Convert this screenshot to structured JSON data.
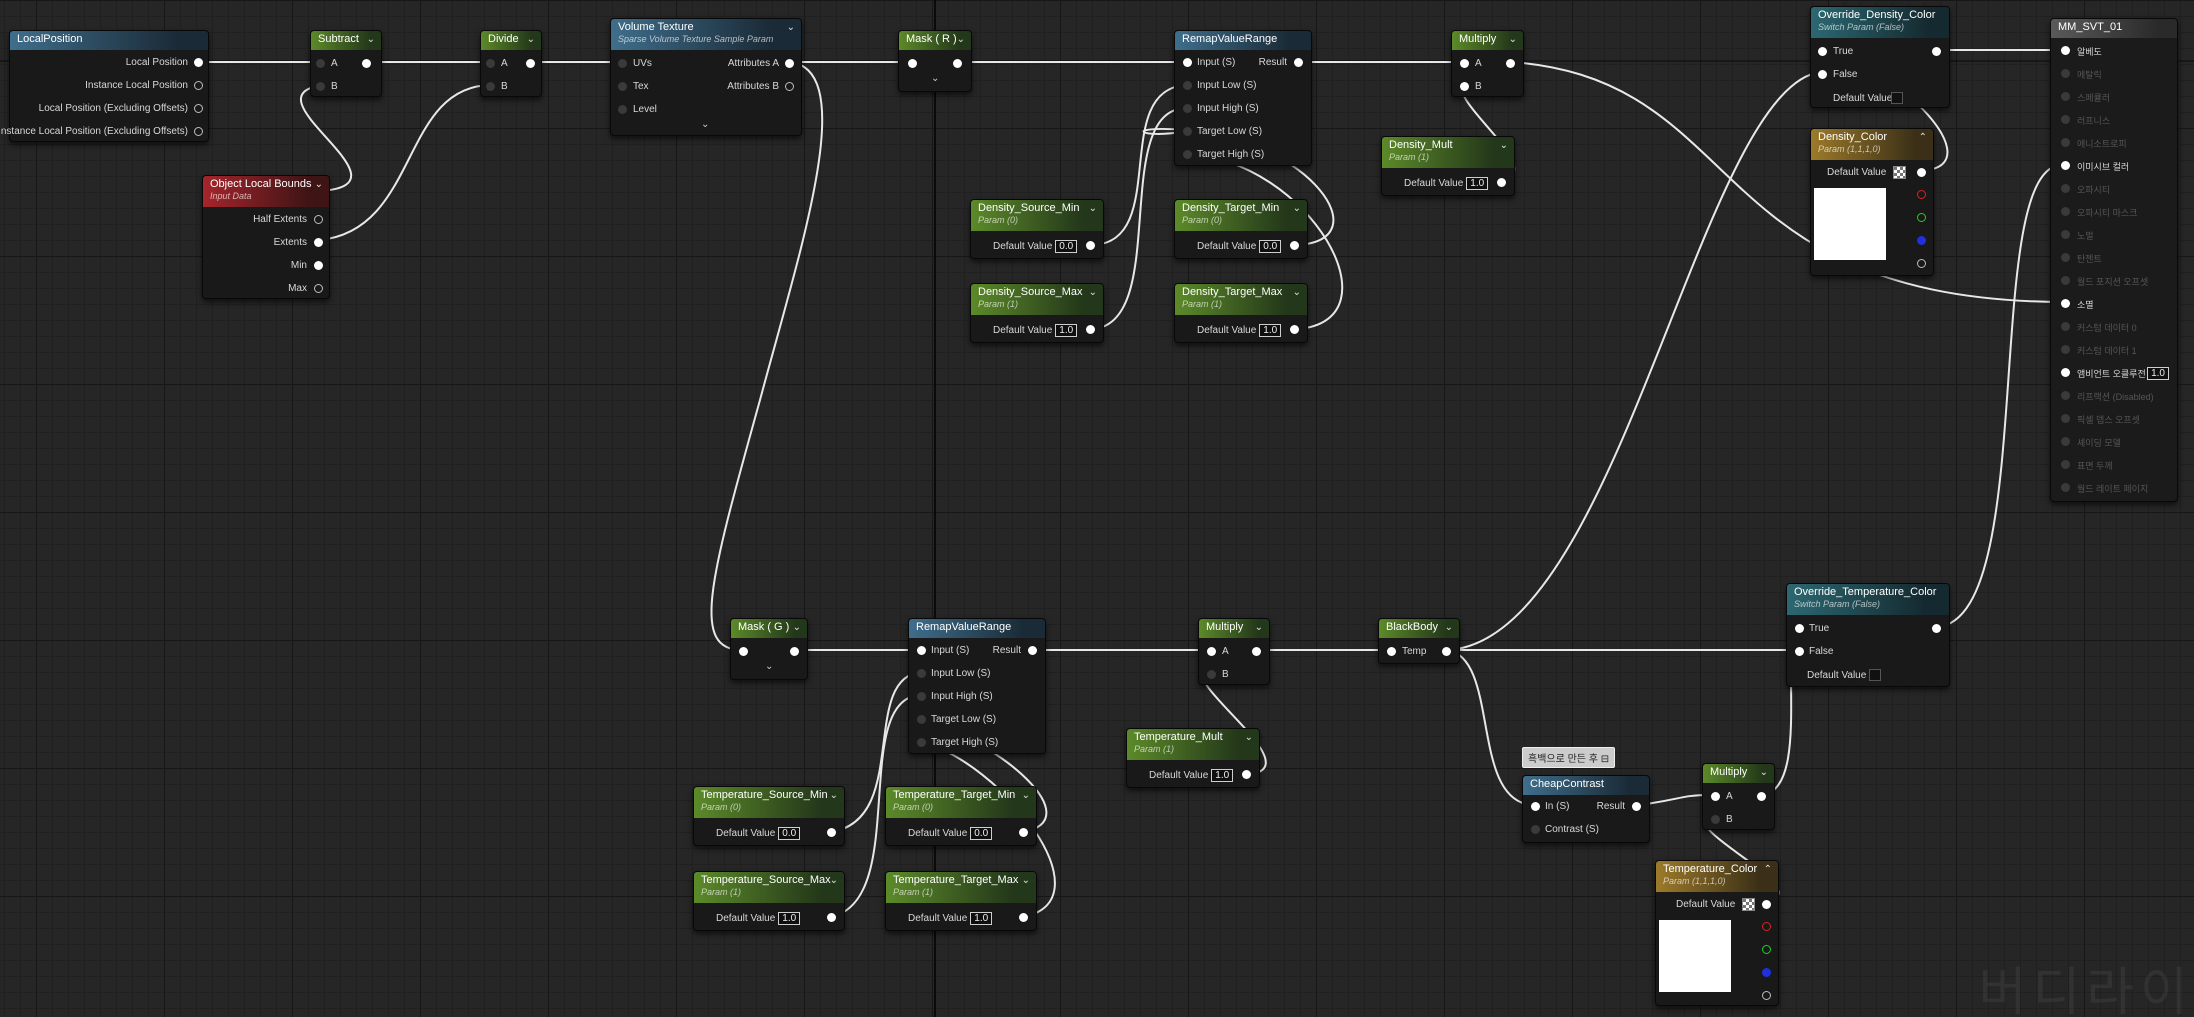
{
  "nodes": {
    "local_position": {
      "title": "LocalPosition",
      "outputs": [
        "Local Position",
        "Instance Local Position",
        "Local Position (Excluding Offsets)",
        "Instance Local Position (Excluding Offsets)"
      ]
    },
    "subtract": {
      "title": "Subtract",
      "a": "A",
      "b": "B"
    },
    "divide": {
      "title": "Divide",
      "a": "A",
      "b": "B"
    },
    "object_local_bounds": {
      "title": "Object Local Bounds",
      "subtitle": "Input Data",
      "outputs": [
        "Half Extents",
        "Extents",
        "Min",
        "Max"
      ]
    },
    "volume_texture": {
      "title": "Volume Texture",
      "subtitle": "Sparse Volume Texture Sample Param",
      "inputs": [
        "UVs",
        "Tex",
        "Level"
      ],
      "outputs": [
        "Attributes A",
        "Attributes B"
      ]
    },
    "mask_r": {
      "title": "Mask ( R )"
    },
    "mask_g": {
      "title": "Mask ( G )"
    },
    "remap_density": {
      "title": "RemapValueRange",
      "inputs": [
        "Input (S)",
        "Input Low (S)",
        "Input High (S)",
        "Target Low (S)",
        "Target High (S)"
      ],
      "output": "Result"
    },
    "remap_temperature": {
      "title": "RemapValueRange",
      "inputs": [
        "Input (S)",
        "Input Low (S)",
        "Input High (S)",
        "Target Low (S)",
        "Target High (S)"
      ],
      "output": "Result"
    },
    "density_source_min": {
      "title": "Density_Source_Min",
      "subtitle": "Param (0)",
      "label": "Default Value",
      "value": "0.0"
    },
    "density_source_max": {
      "title": "Density_Source_Max",
      "subtitle": "Param (1)",
      "label": "Default Value",
      "value": "1.0"
    },
    "density_target_min": {
      "title": "Density_Target_Min",
      "subtitle": "Param (0)",
      "label": "Default Value",
      "value": "0.0"
    },
    "density_target_max": {
      "title": "Density_Target_Max",
      "subtitle": "Param (1)",
      "label": "Default Value",
      "value": "1.0"
    },
    "multiply_density": {
      "title": "Multiply",
      "a": "A",
      "b": "B"
    },
    "density_mult": {
      "title": "Density_Mult",
      "subtitle": "Param (1)",
      "label": "Default Value",
      "value": "1.0"
    },
    "override_density_color": {
      "title": "Override_Density_Color",
      "subtitle": "Switch Param (False)",
      "true": "True",
      "false": "False",
      "default": "Default Value"
    },
    "density_color": {
      "title": "Density_Color",
      "subtitle": "Param (1,1,1,0)",
      "label": "Default Value"
    },
    "temperature_source_min": {
      "title": "Temperature_Source_Min",
      "subtitle": "Param (0)",
      "label": "Default Value",
      "value": "0.0"
    },
    "temperature_source_max": {
      "title": "Temperature_Source_Max",
      "subtitle": "Param (1)",
      "label": "Default Value",
      "value": "1.0"
    },
    "temperature_target_min": {
      "title": "Temperature_Target_Min",
      "subtitle": "Param (0)",
      "label": "Default Value",
      "value": "0.0"
    },
    "temperature_target_max": {
      "title": "Temperature_Target_Max",
      "subtitle": "Param (1)",
      "label": "Default Value",
      "value": "1.0"
    },
    "multiply_temp": {
      "title": "Multiply",
      "a": "A",
      "b": "B"
    },
    "temperature_mult": {
      "title": "Temperature_Mult",
      "subtitle": "Param (1)",
      "label": "Default Value",
      "value": "1.0"
    },
    "blackbody": {
      "title": "BlackBody",
      "input": "Temp"
    },
    "override_temperature_color": {
      "title": "Override_Temperature_Color",
      "subtitle": "Switch Param (False)",
      "true": "True",
      "false": "False",
      "default": "Default Value"
    },
    "comment": {
      "text": "흑백으로 만든 후"
    },
    "cheap_contrast": {
      "title": "CheapContrast",
      "inputs": [
        "In (S)",
        "Contrast (S)"
      ],
      "output": "Result"
    },
    "multiply_contrast": {
      "title": "Multiply",
      "a": "A",
      "b": "B"
    },
    "temperature_color": {
      "title": "Temperature_Color",
      "subtitle": "Param (1,1,1,0)",
      "label": "Default Value"
    }
  },
  "material": {
    "title": "MM_SVT_01",
    "pins": [
      {
        "label": "알베도",
        "active": true
      },
      {
        "label": "메탈릭",
        "active": false
      },
      {
        "label": "스페큘러",
        "active": false
      },
      {
        "label": "러프니스",
        "active": false
      },
      {
        "label": "애니소트로피",
        "active": false
      },
      {
        "label": "이미시브 컬러",
        "active": true
      },
      {
        "label": "오파시티",
        "active": false
      },
      {
        "label": "오파시티 마스크",
        "active": false
      },
      {
        "label": "노멀",
        "active": false
      },
      {
        "label": "탄젠트",
        "active": false
      },
      {
        "label": "월드 포지션 오프셋",
        "active": false
      },
      {
        "label": "소멸",
        "active": true
      },
      {
        "label": "커스텀 데이터 0",
        "active": false
      },
      {
        "label": "커스텀 데이터 1",
        "active": false
      },
      {
        "label": "앰비언트 오클루전",
        "active": true,
        "value": "1.0"
      },
      {
        "label": "리프랙션 (Disabled)",
        "active": false
      },
      {
        "label": "픽셀 뎁스 오프셋",
        "active": false
      },
      {
        "label": "셰이딩 모델",
        "active": false
      },
      {
        "label": "표면 두께",
        "active": false
      },
      {
        "label": "월드 레이트 페이지",
        "active": false
      }
    ]
  },
  "watermark": "버디라이"
}
